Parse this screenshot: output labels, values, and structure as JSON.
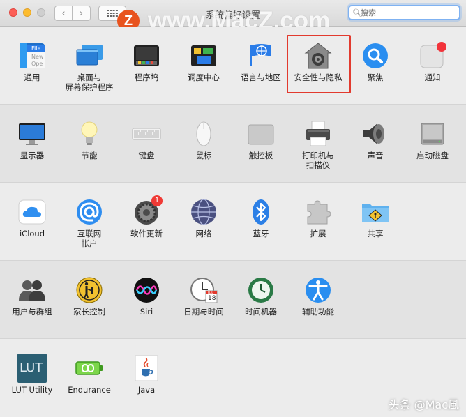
{
  "window": {
    "title": "系统偏好设置"
  },
  "search": {
    "placeholder": "搜索",
    "value": ""
  },
  "watermark": {
    "logo_letter": "Z",
    "text": "www.MacZ.com",
    "footer": "头条 @Mac風"
  },
  "colors": {
    "highlight": "#e23a2e",
    "accent": "#2a7ce8"
  },
  "sections": [
    {
      "panes": [
        {
          "id": "general",
          "label": "通用",
          "icon": "general-icon"
        },
        {
          "id": "desktop",
          "label": "桌面与\n屏幕保护程序",
          "icon": "desktop-icon"
        },
        {
          "id": "dock",
          "label": "程序坞",
          "icon": "dock-icon"
        },
        {
          "id": "mission-control",
          "label": "调度中心",
          "icon": "mission-control-icon"
        },
        {
          "id": "language",
          "label": "语言与地区",
          "icon": "language-icon"
        },
        {
          "id": "security",
          "label": "安全性与隐私",
          "icon": "security-house-icon"
        },
        {
          "id": "spotlight",
          "label": "聚焦",
          "icon": "spotlight-icon"
        },
        {
          "id": "notifications",
          "label": "通知",
          "icon": "notifications-icon"
        }
      ]
    },
    {
      "panes": [
        {
          "id": "displays",
          "label": "显示器",
          "icon": "display-icon"
        },
        {
          "id": "energy",
          "label": "节能",
          "icon": "bulb-icon"
        },
        {
          "id": "keyboard",
          "label": "键盘",
          "icon": "keyboard-icon"
        },
        {
          "id": "mouse",
          "label": "鼠标",
          "icon": "mouse-icon"
        },
        {
          "id": "trackpad",
          "label": "触控板",
          "icon": "trackpad-icon"
        },
        {
          "id": "printers",
          "label": "打印机与\n扫描仪",
          "icon": "printer-icon"
        },
        {
          "id": "sound",
          "label": "声音",
          "icon": "speaker-icon"
        },
        {
          "id": "startup-disk",
          "label": "启动磁盘",
          "icon": "disk-icon"
        }
      ]
    },
    {
      "panes": [
        {
          "id": "icloud",
          "label": "iCloud",
          "icon": "cloud-icon"
        },
        {
          "id": "internet-accounts",
          "label": "互联网\n帐户",
          "icon": "at-icon"
        },
        {
          "id": "software-update",
          "label": "软件更新",
          "icon": "gear-icon",
          "badge": "1"
        },
        {
          "id": "network",
          "label": "网络",
          "icon": "globe-icon"
        },
        {
          "id": "bluetooth",
          "label": "蓝牙",
          "icon": "bluetooth-icon"
        },
        {
          "id": "extensions",
          "label": "扩展",
          "icon": "puzzle-icon"
        },
        {
          "id": "sharing",
          "label": "共享",
          "icon": "sharing-folder-icon"
        }
      ]
    },
    {
      "panes": [
        {
          "id": "users",
          "label": "用户与群组",
          "icon": "users-icon"
        },
        {
          "id": "parental",
          "label": "家长控制",
          "icon": "parental-icon"
        },
        {
          "id": "siri",
          "label": "Siri",
          "icon": "siri-icon"
        },
        {
          "id": "date-time",
          "label": "日期与时间",
          "icon": "clock-calendar-icon",
          "calendar_month": "JUL",
          "calendar_day": "18"
        },
        {
          "id": "time-machine",
          "label": "时间机器",
          "icon": "time-machine-icon"
        },
        {
          "id": "accessibility",
          "label": "辅助功能",
          "icon": "accessibility-icon"
        }
      ]
    },
    {
      "panes": [
        {
          "id": "lut-utility",
          "label": "LUT Utility",
          "icon": "lut-icon",
          "icon_text": "LUT"
        },
        {
          "id": "endurance",
          "label": "Endurance",
          "icon": "battery-infinity-icon"
        },
        {
          "id": "java",
          "label": "Java",
          "icon": "java-cup-icon"
        }
      ]
    }
  ],
  "general_icon_text": {
    "line1": "File",
    "line2": "New",
    "line3": "Ope"
  }
}
